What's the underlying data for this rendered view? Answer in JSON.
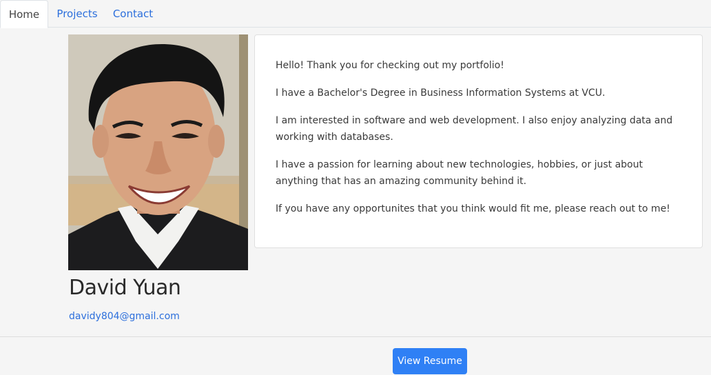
{
  "nav": {
    "tabs": [
      {
        "label": "Home",
        "active": true
      },
      {
        "label": "Projects",
        "active": false
      },
      {
        "label": "Contact",
        "active": false
      }
    ]
  },
  "profile": {
    "photo_icon": "portrait-photo",
    "name": "David Yuan",
    "email": "davidy804@gmail.com"
  },
  "about": {
    "paragraphs": [
      "Hello! Thank you for checking out my portfolio!",
      "I have a Bachelor's Degree in Business Information Systems at VCU.",
      "I am interested in software and web development. I also enjoy analyzing data and working with databases.",
      "I have a passion for learning about new technologies, hobbies, or just about anything that has an amazing community behind it.",
      "If you have any opportunites that you think would fit me, please reach out to me!"
    ]
  },
  "actions": {
    "resume_label": "View Resume"
  },
  "colors": {
    "accent": "#2f80f5",
    "link": "#2c6fdc",
    "background": "#f5f5f5"
  }
}
